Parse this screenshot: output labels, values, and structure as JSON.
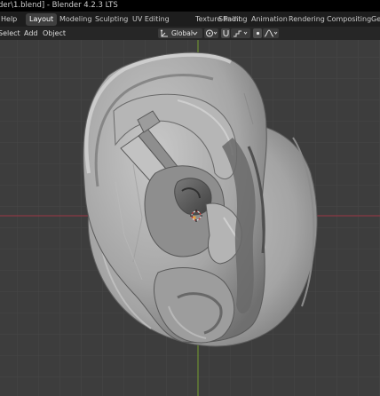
{
  "window": {
    "title": "der\\1.blend] - Blender 4.2.3 LTS"
  },
  "menubar": {
    "help_label": "Help",
    "workspace_tabs": [
      {
        "label": "Layout",
        "active": true
      },
      {
        "label": "Modeling",
        "active": false
      },
      {
        "label": "Sculpting",
        "active": false
      },
      {
        "label": "UV Editing",
        "active": false
      },
      {
        "label": "Texture Paint",
        "active": false
      },
      {
        "label": "Shading",
        "active": false
      },
      {
        "label": "Animation",
        "active": false
      },
      {
        "label": "Rendering",
        "active": false
      },
      {
        "label": "Compositing",
        "active": false
      },
      {
        "label": "Ge",
        "active": false
      }
    ]
  },
  "toolbar": {
    "select_label": "Select",
    "add_label": "Add",
    "object_label": "Object",
    "transform_orientation": "Global",
    "icons": [
      "transform-orientation-icon",
      "chevron-down-icon",
      "pivot-point-icon",
      "snap-icon",
      "snap-increment-icon",
      "proportional-editing-icon",
      "falloff-curve-icon"
    ],
    "proportional_editing_enabled": true
  },
  "viewport": {
    "background_color": "#3d3d3d",
    "x_axis_color": "#8a3a44",
    "y_axis_color": "#6a8a32",
    "grid_color": "#474747",
    "object": "ear-mesh",
    "mesh_shade": "#a9a9a9",
    "cursor": "3d-cursor-icon"
  }
}
